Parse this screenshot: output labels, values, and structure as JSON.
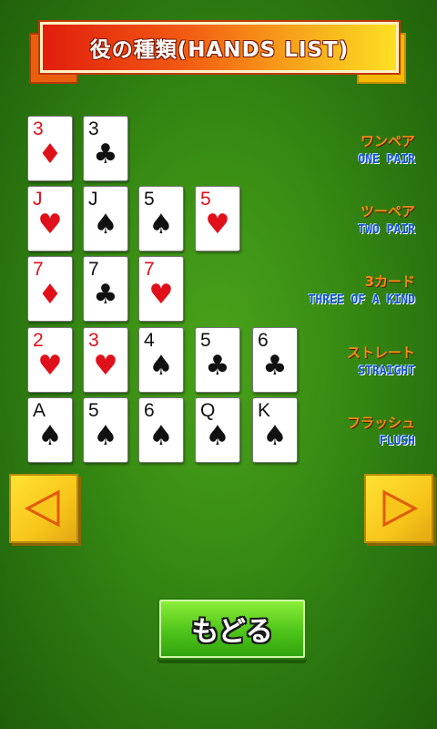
{
  "header": {
    "title": "役の種類(HANDS LIST)"
  },
  "hands": [
    {
      "name_jp": "ワンペア",
      "name_en": "ONE PAIR",
      "cards": [
        {
          "rank": "3",
          "suit": "♦",
          "color": "red"
        },
        {
          "rank": "3",
          "suit": "♣",
          "color": "black"
        }
      ]
    },
    {
      "name_jp": "ツーペア",
      "name_en": "TWO PAIR",
      "cards": [
        {
          "rank": "J",
          "suit": "♥",
          "color": "red"
        },
        {
          "rank": "J",
          "suit": "♠",
          "color": "black"
        },
        {
          "rank": "5",
          "suit": "♠",
          "color": "black"
        },
        {
          "rank": "5",
          "suit": "♥",
          "color": "red"
        }
      ]
    },
    {
      "name_jp": "3カード",
      "name_en": "THREE OF A KIND",
      "cards": [
        {
          "rank": "7",
          "suit": "♦",
          "color": "red"
        },
        {
          "rank": "7",
          "suit": "♣",
          "color": "black"
        },
        {
          "rank": "7",
          "suit": "♥",
          "color": "red"
        }
      ]
    },
    {
      "name_jp": "ストレート",
      "name_en": "STRAIGHT",
      "cards": [
        {
          "rank": "2",
          "suit": "♥",
          "color": "red"
        },
        {
          "rank": "3",
          "suit": "♥",
          "color": "red"
        },
        {
          "rank": "4",
          "suit": "♠",
          "color": "black"
        },
        {
          "rank": "5",
          "suit": "♣",
          "color": "black"
        },
        {
          "rank": "6",
          "suit": "♣",
          "color": "black"
        }
      ]
    },
    {
      "name_jp": "フラッシュ",
      "name_en": "FLUSH",
      "cards": [
        {
          "rank": "A",
          "suit": "♠",
          "color": "black"
        },
        {
          "rank": "5",
          "suit": "♠",
          "color": "black"
        },
        {
          "rank": "6",
          "suit": "♠",
          "color": "black"
        },
        {
          "rank": "Q",
          "suit": "♠",
          "color": "black"
        },
        {
          "rank": "K",
          "suit": "♠",
          "color": "black"
        }
      ]
    }
  ],
  "nav": {
    "prev_icon": "left-triangle-icon",
    "next_icon": "right-triangle-icon",
    "back_label": "もどる"
  },
  "colors": {
    "felt": "#3a8f14",
    "suit_red": "#e0101a",
    "hand_jp": "#f58a12",
    "hand_en": "#1a52c8",
    "arrow_button": "#f7c61a",
    "back_button": "#4ec41a"
  }
}
